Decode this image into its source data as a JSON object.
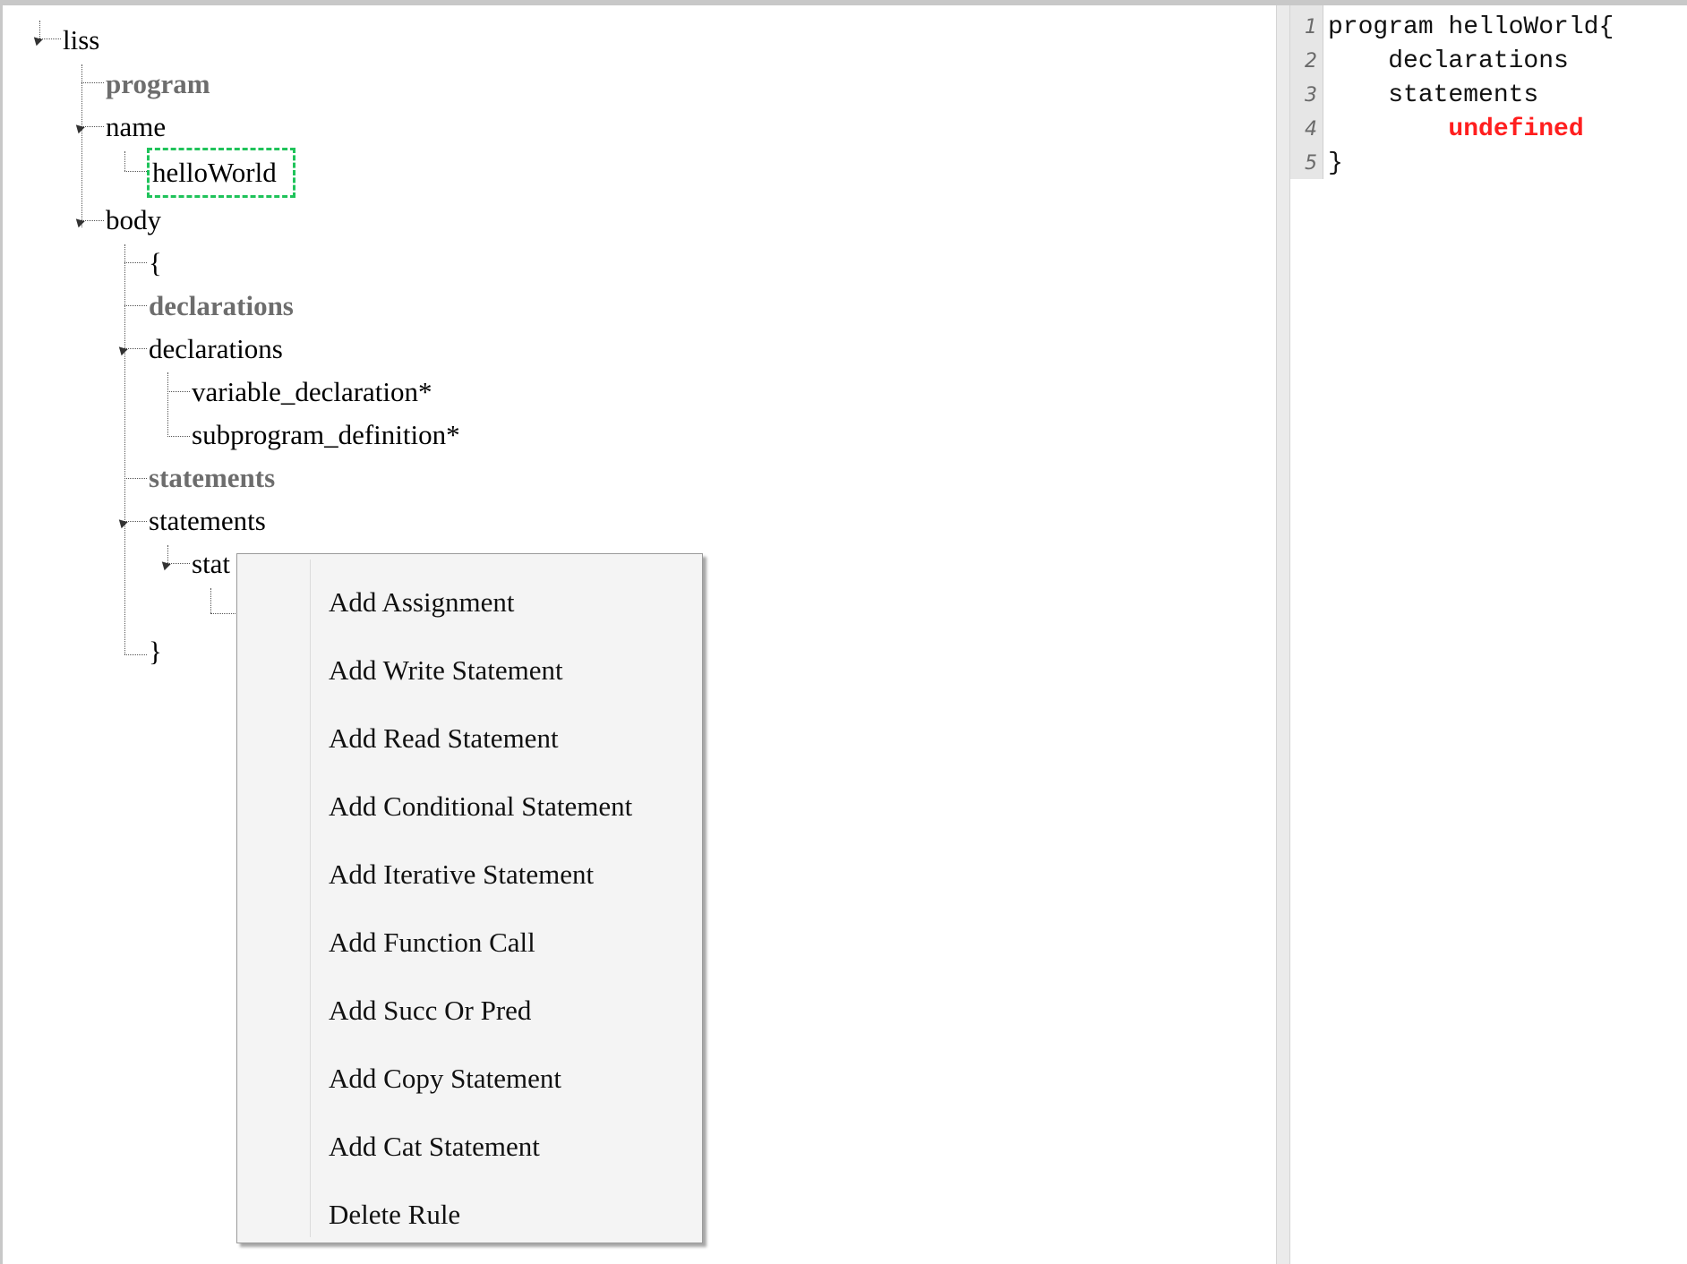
{
  "tree": {
    "nodes": {
      "root": "liss",
      "program_kw": "program",
      "name": "name",
      "name_value": "helloWorld",
      "body": "body",
      "open_brace": "{",
      "declarations_kw": "declarations",
      "declarations": "declarations",
      "variable_declaration": "variable_declaration*",
      "subprogram_definition": "subprogram_definition*",
      "statements_kw": "statements",
      "statements": "statements",
      "statement_partial": "stat",
      "close_brace": "}"
    }
  },
  "context_menu": {
    "items": [
      {
        "label": "Add Assignment"
      },
      {
        "label": "Add Write Statement"
      },
      {
        "label": "Add Read Statement"
      },
      {
        "label": "Add Conditional Statement"
      },
      {
        "label": "Add Iterative Statement"
      },
      {
        "label": "Add Function Call"
      },
      {
        "label": "Add Succ Or Pred"
      },
      {
        "label": "Add Copy Statement"
      },
      {
        "label": "Add Cat Statement"
      },
      {
        "label": "Delete Rule"
      }
    ]
  },
  "code": {
    "lines": [
      {
        "num": "1",
        "text": "program helloWorld{"
      },
      {
        "num": "2",
        "text": "    declarations"
      },
      {
        "num": "3",
        "text": "    statements"
      },
      {
        "num": "4",
        "text": "        undefined"
      },
      {
        "num": "5",
        "text": "}"
      }
    ],
    "error_color": "#ff1e1e"
  },
  "colors": {
    "selection_border": "#1fc35a",
    "keyword_gray": "#6d6d6d"
  }
}
